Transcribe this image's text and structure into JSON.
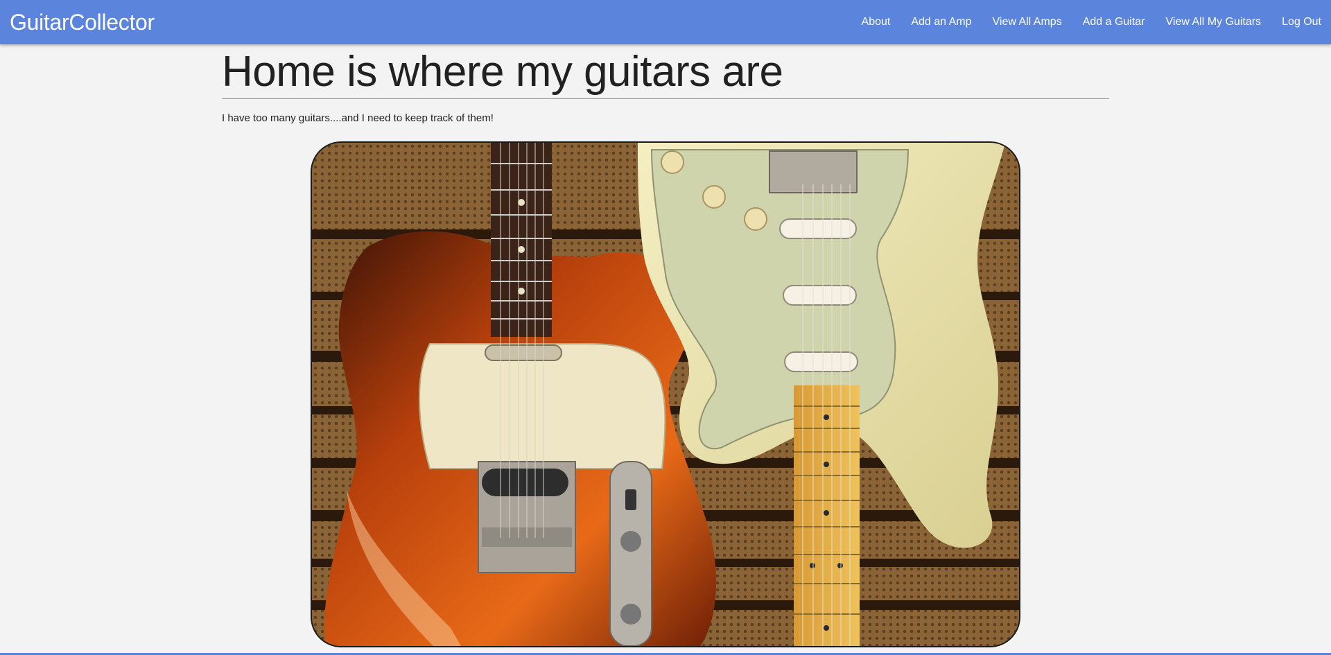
{
  "navbar": {
    "brand": "GuitarCollector",
    "links": [
      {
        "label": "About"
      },
      {
        "label": "Add an Amp"
      },
      {
        "label": "View All Amps"
      },
      {
        "label": "Add a Guitar"
      },
      {
        "label": "View All My Guitars"
      },
      {
        "label": "Log Out"
      }
    ]
  },
  "main": {
    "title": "Home is where my guitars are",
    "intro": "I have too many guitars....and I need to keep track of them!"
  },
  "colors": {
    "navbar": "#5b84dd",
    "background": "#f3f3f3",
    "text": "#212121"
  }
}
